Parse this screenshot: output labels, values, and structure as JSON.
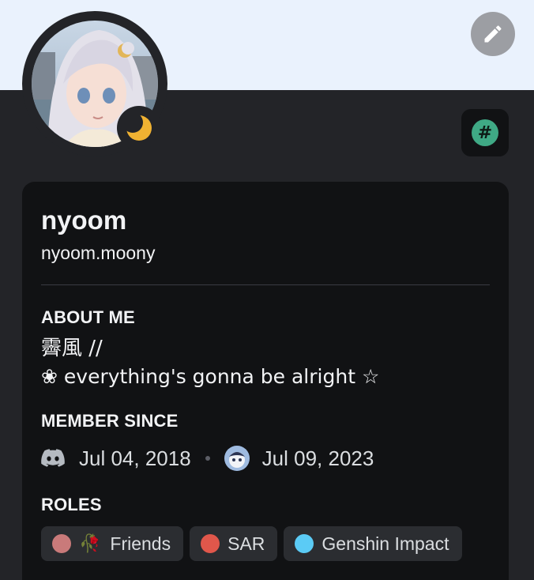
{
  "profile": {
    "display_name": "nyoom",
    "username": "nyoom.moony",
    "status_icon": "moon-icon",
    "edit_icon": "pencil-icon",
    "badge_icon": "hash-icon"
  },
  "about": {
    "title": "ABOUT ME",
    "line1": "霽風 //",
    "line2": "❀ everything's gonna be alright ☆"
  },
  "member_since": {
    "title": "MEMBER SINCE",
    "discord_date": "Jul 04, 2018",
    "server_date": "Jul 09, 2023"
  },
  "roles": {
    "title": "ROLES",
    "items": [
      {
        "label": "Friends",
        "color": "#c97a7a",
        "emoji": "🥀"
      },
      {
        "label": "SAR",
        "color": "#e0574b"
      },
      {
        "label": "Genshin Impact",
        "color": "#5bcbf5"
      }
    ]
  },
  "colors": {
    "banner": "#eaf2fd",
    "background": "#232428",
    "card": "#111214",
    "status_moon": "#f0b232",
    "badge_green": "#3fa985"
  }
}
